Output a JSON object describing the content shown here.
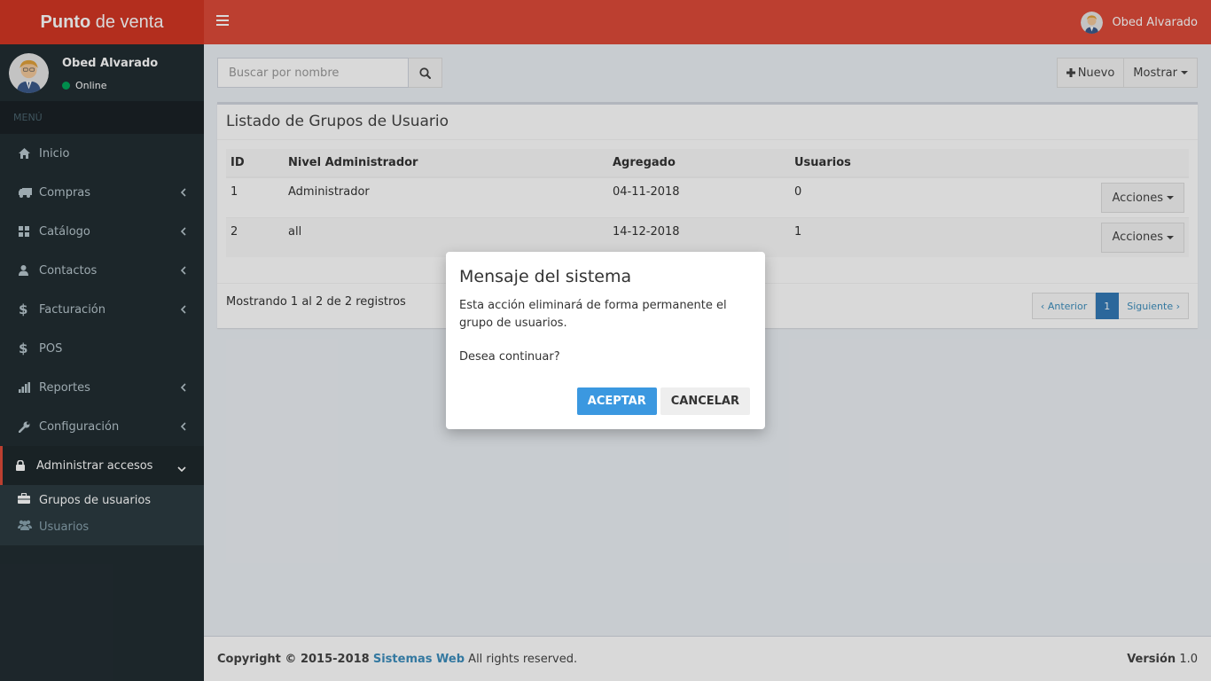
{
  "app": {
    "title_bold": "Punto",
    "title_rest": "de venta"
  },
  "header": {
    "user_name": "Obed Alvarado"
  },
  "sidebar": {
    "user_name": "Obed Alvarado",
    "status": "Online",
    "menu_header": "MENÚ",
    "items": [
      {
        "label": "Inicio",
        "icon": "home-icon"
      },
      {
        "label": "Compras",
        "icon": "truck-icon"
      },
      {
        "label": "Catálogo",
        "icon": "grid-icon"
      },
      {
        "label": "Contactos",
        "icon": "user-icon"
      },
      {
        "label": "Facturación",
        "icon": "dollar-icon"
      },
      {
        "label": "POS",
        "icon": "dollar-icon"
      },
      {
        "label": "Reportes",
        "icon": "bar-chart-icon"
      },
      {
        "label": "Configuración",
        "icon": "wrench-icon"
      },
      {
        "label": "Administrar accesos",
        "icon": "lock-icon"
      }
    ],
    "submenu": [
      {
        "label": "Grupos de usuarios",
        "icon": "briefcase-icon"
      },
      {
        "label": "Usuarios",
        "icon": "users-icon"
      }
    ]
  },
  "toolbar": {
    "search_placeholder": "Buscar por nombre",
    "new_label": "Nuevo",
    "show_label": "Mostrar"
  },
  "box": {
    "title": "Listado de Grupos de Usuario",
    "columns": [
      "ID",
      "Nivel Administrador",
      "Agregado",
      "Usuarios"
    ],
    "rows": [
      {
        "id": "1",
        "nivel": "Administrador",
        "agregado": "04-11-2018",
        "usuarios": "0",
        "action": "Acciones"
      },
      {
        "id": "2",
        "nivel": "all",
        "agregado": "14-12-2018",
        "usuarios": "1",
        "action": "Acciones"
      }
    ],
    "showing": "Mostrando 1 al 2 de 2 registros",
    "pagination": {
      "prev": "‹ Anterior",
      "page": "1",
      "next": "Siguiente ›"
    }
  },
  "footer": {
    "copyright": "Copyright © 2015-2018",
    "company": "Sistemas Web",
    "rights": "All rights reserved.",
    "version_label": "Versión",
    "version": "1.0"
  },
  "dialog": {
    "title": "Mensaje del sistema",
    "message": "Esta acción eliminará de forma permanente el grupo de usuarios.",
    "question": "Desea continuar?",
    "accept": "ACEPTAR",
    "cancel": "CANCELAR"
  },
  "colors": {
    "header": "#dd4b39",
    "logo": "#d33724",
    "sidebar": "#222d32",
    "accent": "#3c8dbc"
  }
}
